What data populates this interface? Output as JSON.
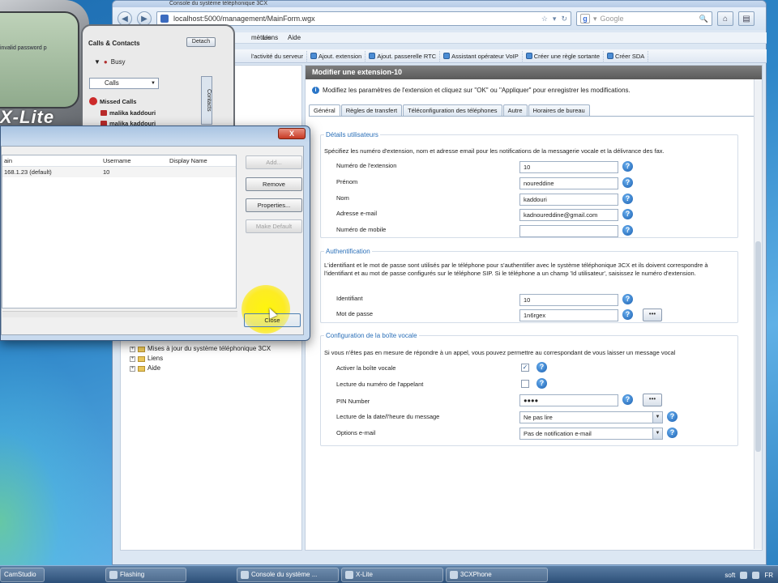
{
  "browser": {
    "title": "Console du système téléphonique 3CX",
    "url": "localhost:5000/management/MainForm.wgx",
    "search_placeholder": "Google",
    "back_icon": "back-arrow-icon",
    "forward_icon": "forward-arrow-icon"
  },
  "menubar": {
    "items": [
      "mètres",
      "Liens",
      "Aide"
    ]
  },
  "toolbar": {
    "items": [
      "l'activité du serveur",
      "Ajout. extension",
      "Ajout. passerelle RTC",
      "Assistant opérateur VoIP",
      "Créer une règle sortante",
      "Créer SDA"
    ]
  },
  "tree": {
    "items": [
      "Mises à jour du système téléphonique 3CX",
      "Liens",
      "Aide"
    ]
  },
  "panel": {
    "header": "Modifier une extension-10",
    "description": "Modifiez les paramètres de l'extension et cliquez sur \"OK\" ou \"Appliquer\" pour enregistrer les modifications.",
    "tabs": [
      "Général",
      "Règles de transfert",
      "Téléconfiguration des téléphones",
      "Autre",
      "Horaires de bureau"
    ]
  },
  "user_details": {
    "title": "Détails utilisateurs",
    "desc": "Spécifiez les numéro d'extension, nom et adresse email pour les notifications de la messagerie vocale et la délivrance des fax.",
    "fields": [
      {
        "label": "Numéro de l'extension",
        "value": "10"
      },
      {
        "label": "Prénom",
        "value": "noureddine"
      },
      {
        "label": "Nom",
        "value": "kaddouri"
      },
      {
        "label": "Adresse e-mail",
        "value": "kadnoureddine@gmail.com"
      },
      {
        "label": "Numéro de mobile",
        "value": ""
      }
    ]
  },
  "auth": {
    "title": "Authentification",
    "desc": "L'identifiant et le mot de passe sont utilisés par le téléphone pour s'authentifier avec le système téléphonique 3CX et ils doivent correspondre à l'identifiant et au mot de passe configurés sur le téléphone SIP. Si le téléphone a un champ 'Id utilisateur', saisissez le numéro d'extension.",
    "id_label": "Identifiant",
    "id_value": "10",
    "pw_label": "Mot de passe",
    "pw_value": "1n6rgex",
    "dots": "•••"
  },
  "voicemail": {
    "title": "Configuration de la boîte vocale",
    "desc": "Si vous n'êtes pas en mesure de répondre à un appel, vous pouvez permettre au correspondant de vous laisser un message vocal",
    "enable_label": "Activer la boîte vocale",
    "enable_checked": "✓",
    "callerid_label": "Lecture du numéro de l'appelant",
    "pin_label": "PIN Number",
    "pin_value": "●●●●",
    "dots": "•••",
    "datetime_label": "Lecture de la date/l'heure du message",
    "datetime_value": "Ne pas lire",
    "email_label": "Options e-mail",
    "email_value": "Pas de notification e-mail"
  },
  "xlite": {
    "brand": "X-Lite",
    "screen_text": "invalid password p",
    "contacts_title": "Calls & Contacts",
    "detach": "Detach",
    "status": "Busy",
    "calls": "Calls",
    "missed": "Missed Calls",
    "entries": [
      "malika kaddouri",
      "malika kaddouri"
    ],
    "vtab": "Contacts"
  },
  "dialog": {
    "close_x": "X",
    "columns": [
      "ain",
      "Username",
      "Display Name"
    ],
    "row": {
      "domain": "168.1.23 (default)",
      "username": "10",
      "display": ""
    },
    "buttons": {
      "add": "Add...",
      "remove": "Remove",
      "properties": "Properties...",
      "make_default": "Make Default",
      "close": "Close"
    }
  },
  "taskbar": {
    "items": [
      "CamStudio",
      "Flashing",
      "Console du système ...",
      "X-Lite",
      "3CXPhone"
    ],
    "tray_text": "soft",
    "lang": "FR"
  },
  "colors": {
    "accent": "#2a6fb8",
    "header_bg": "#6a6a6a",
    "highlight": "#ffef00"
  }
}
